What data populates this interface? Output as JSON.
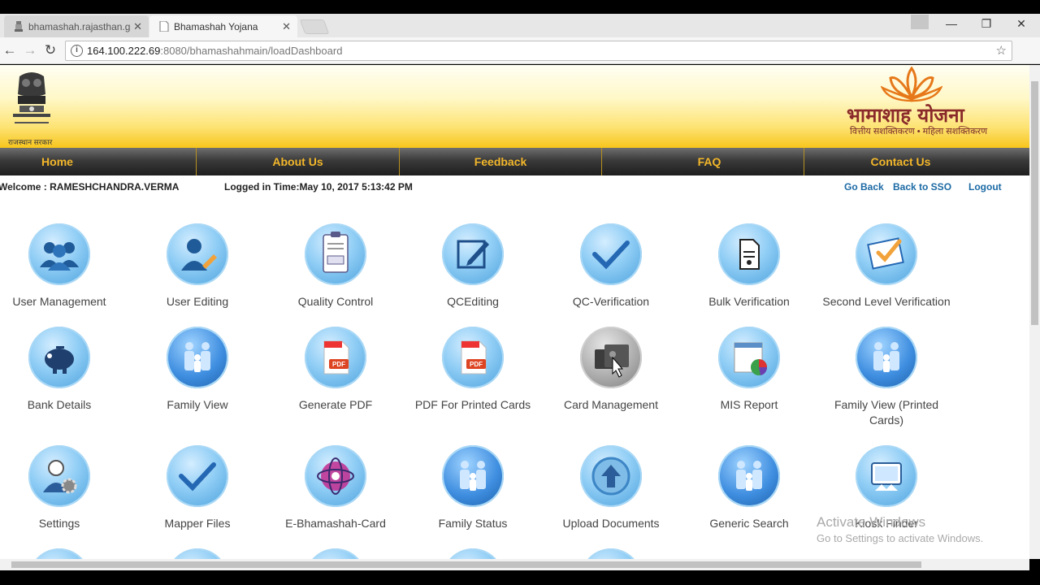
{
  "browser": {
    "tabs": [
      {
        "title": "bhamashah.rajasthan.go",
        "state": "inactive"
      },
      {
        "title": "Bhamashah Yojana",
        "state": "active"
      }
    ],
    "url_host": "164.100.222.69",
    "url_path": ":8080/bhamashahmain/loadDashboard"
  },
  "header": {
    "emblem_caption": "राजस्थान सरकार",
    "brand_title": "भामाशाह योजना",
    "brand_subtitle": "वित्तीय सशक्तिकरण • महिला सशक्तिकरण"
  },
  "nav": [
    "Home",
    "About Us",
    "Feedback",
    "FAQ",
    "Contact Us"
  ],
  "session": {
    "welcome": "Welcome : RAMESHCHANDRA.VERMA",
    "logged_in": "Logged in Time:May 10, 2017 5:13:42 PM",
    "links": [
      "Go Back",
      "Back to SSO",
      "Logout"
    ]
  },
  "tiles": [
    {
      "label": "User Management",
      "icon": "users-group-icon"
    },
    {
      "label": "User Editing",
      "icon": "user-edit-icon"
    },
    {
      "label": "Quality Control",
      "icon": "clipboard-check-icon"
    },
    {
      "label": "QCEditing",
      "icon": "pencil-square-icon"
    },
    {
      "label": "QC-Verification",
      "icon": "checkmark-icon"
    },
    {
      "label": "Bulk Verification",
      "icon": "document-icon"
    },
    {
      "label": "Second Level Verification",
      "icon": "checklist-icon"
    },
    {
      "label": "Bank Details",
      "icon": "piggy-bank-icon"
    },
    {
      "label": "Family View",
      "icon": "family-icon"
    },
    {
      "label": "Generate PDF",
      "icon": "pdf-icon"
    },
    {
      "label": "PDF For Printed Cards",
      "icon": "pdf-icon"
    },
    {
      "label": "Card Management",
      "icon": "card-folder-icon"
    },
    {
      "label": "MIS Report",
      "icon": "report-chart-icon"
    },
    {
      "label": "Family View (Printed Cards)",
      "icon": "family-icon"
    },
    {
      "label": "Settings",
      "icon": "user-settings-icon"
    },
    {
      "label": "Mapper Files",
      "icon": "checkmark-icon"
    },
    {
      "label": "E-Bhamashah-Card",
      "icon": "globe-people-icon"
    },
    {
      "label": "Family Status",
      "icon": "family-icon"
    },
    {
      "label": "Upload Documents",
      "icon": "upload-arrow-icon"
    },
    {
      "label": "Generic Search",
      "icon": "family-icon"
    },
    {
      "label": "Kiosk Finder",
      "icon": "kiosk-screen-icon"
    }
  ],
  "watermark": {
    "line1": "Activate Windows",
    "line2": "Go to Settings to activate Windows."
  },
  "colors": {
    "nav_text": "#f3b72a",
    "link": "#1b6aa5",
    "icon_blue": "#4aa0dc"
  }
}
